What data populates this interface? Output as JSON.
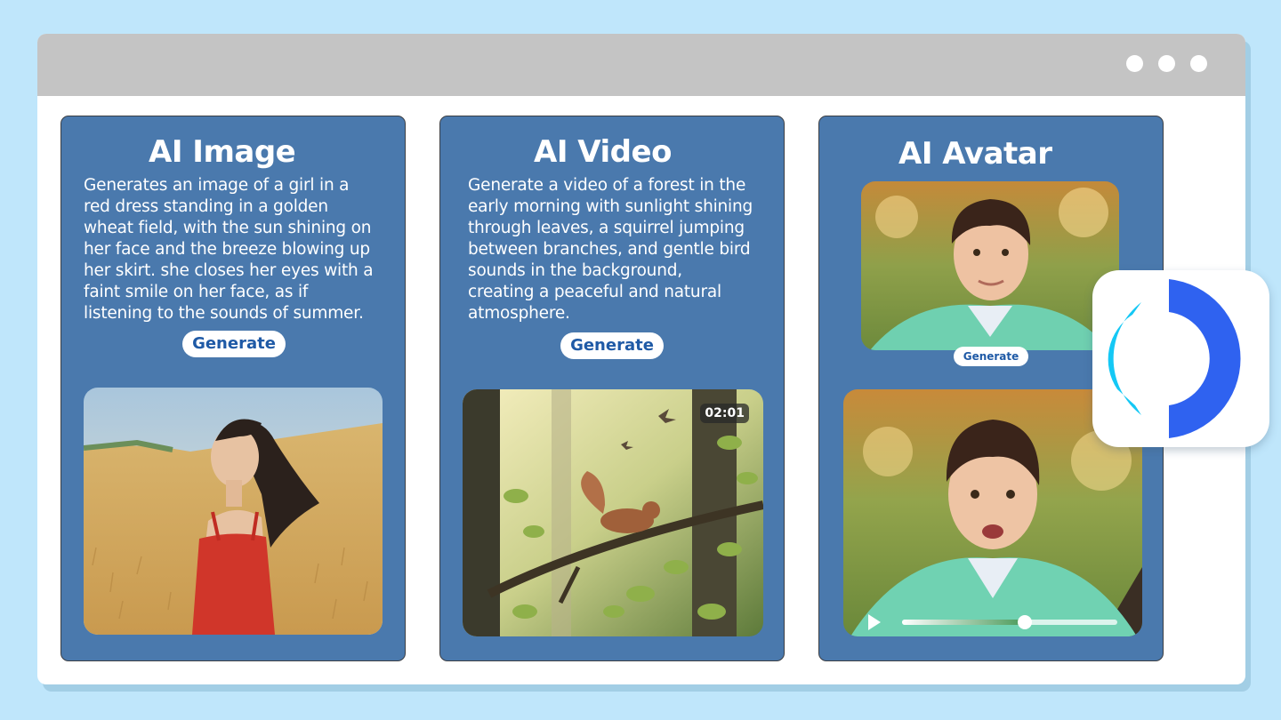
{
  "window": {
    "controls": [
      "dot",
      "dot",
      "dot"
    ]
  },
  "cards": [
    {
      "title": "AI Image",
      "description_lines": [
        "Generates an image of a girl in a",
        "red dress standing in a golden",
        "wheat field, with the sun shining on",
        "her face and the breeze blowing up",
        "her skirt. she closes her eyes with a",
        "faint smile on her face, as if",
        "listening to the sounds of summer."
      ],
      "button": "Generate"
    },
    {
      "title": "AI Video",
      "description_lines": [
        "Generate a video of a forest in the",
        "early morning with sunlight shining",
        "through leaves, a squirrel jumping",
        "between branches, and gentle bird",
        "sounds in the background,",
        "creating a peaceful and natural",
        "atmosphere."
      ],
      "button": "Generate",
      "video_duration": "02:01"
    },
    {
      "title": "AI Avatar",
      "button": "Generate",
      "player": {
        "progress": 0.57
      }
    }
  ],
  "colors": {
    "card_bg": "#4a79ad",
    "button_text": "#1f5aa6",
    "logo_cyan": "#15c8f5",
    "logo_blue": "#2f62f0"
  },
  "icons": [
    "play-icon",
    "app-logo-icon"
  ]
}
